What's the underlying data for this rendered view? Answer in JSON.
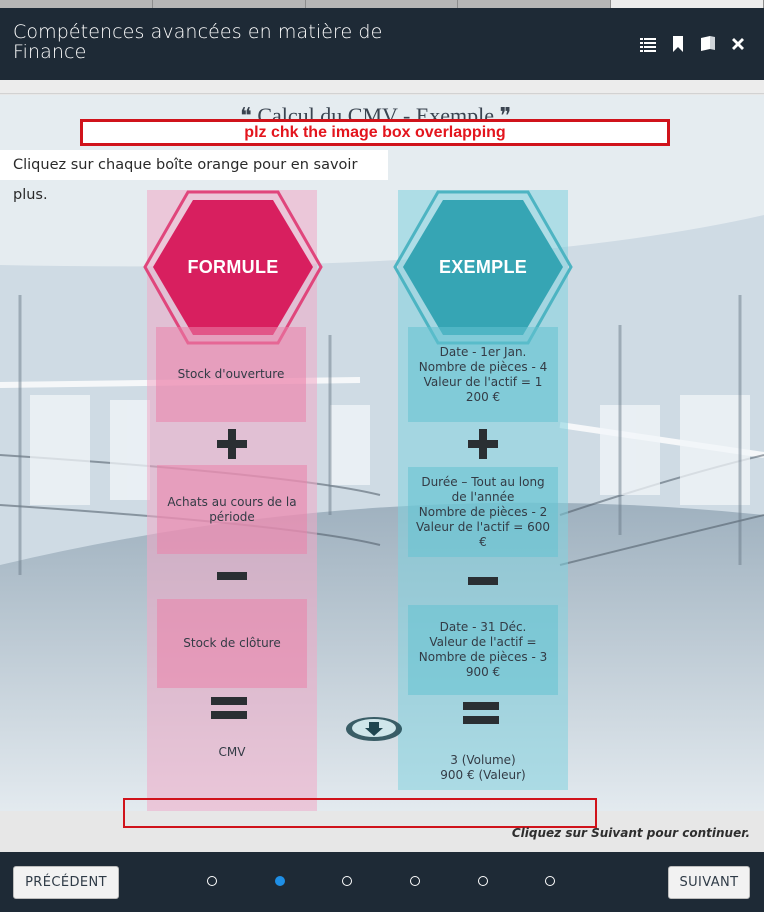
{
  "header": {
    "title": "Compétences avancées en matière de Finance",
    "icons": [
      "list-icon",
      "bookmark-icon",
      "book-icon",
      "close-icon"
    ]
  },
  "tabs": {
    "count": 5,
    "active_index": 4
  },
  "stage": {
    "ghost_title": "❝ Calcul du CMV - Exemple ❞",
    "overlay_note": "plz chk the image box overlapping",
    "instruction": "Cliquez sur chaque boîte orange pour en savoir plus.",
    "formule": {
      "title": "FORMULE",
      "color": "#d81f5f",
      "items": [
        "Stock d'ouverture",
        "Achats au cours de la période",
        "Stock de clôture",
        "CMV"
      ]
    },
    "exemple": {
      "title": "EXEMPLE",
      "color": "#36a5b4",
      "items": [
        "Date - 1er Jan.\nNombre de pièces - 4\nValeur de l'actif = 1 200 €",
        "Durée – Tout au long de l'année\nNombre de pièces - 2\nValeur de l'actif = 600 €",
        "Date - 31 Déc.\nValeur de l'actif =\nNombre de pièces - 3\n900 €",
        "3 (Volume)\n900 € (Valeur)"
      ]
    },
    "continue_text": "Cliquez sur Suivant pour continuer."
  },
  "footer": {
    "prev_label": "PRÉCÉDENT",
    "next_label": "SUIVANT",
    "dots": 6,
    "active_dot": 1,
    "accent": "#1f8fe6"
  }
}
